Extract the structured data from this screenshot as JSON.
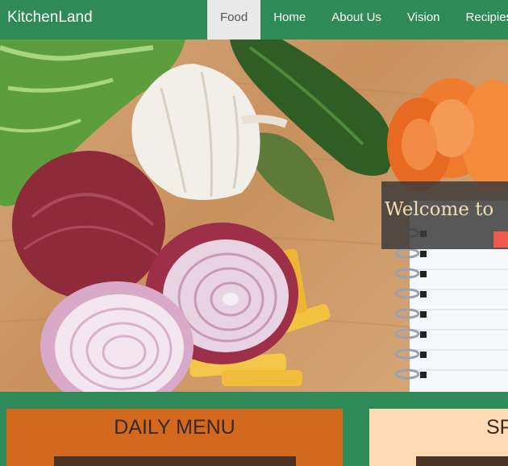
{
  "brand": "KitchenLand",
  "nav": {
    "items": [
      {
        "label": "Food",
        "active": true
      },
      {
        "label": "Home",
        "active": false
      },
      {
        "label": "About Us",
        "active": false
      },
      {
        "label": "Vision",
        "active": false
      },
      {
        "label": "Recipies",
        "active": false
      }
    ]
  },
  "hero": {
    "welcome_text": "Welcome to"
  },
  "cards": {
    "daily_title": "DAILY MENU",
    "special_title": "SP"
  },
  "colors": {
    "nav_bg": "#2e8b57",
    "active_tab_bg": "#e9e9e9",
    "daily_card": "#d2691e",
    "special_card": "#ffdcb5",
    "welcome_accent": "#f05a4e"
  }
}
